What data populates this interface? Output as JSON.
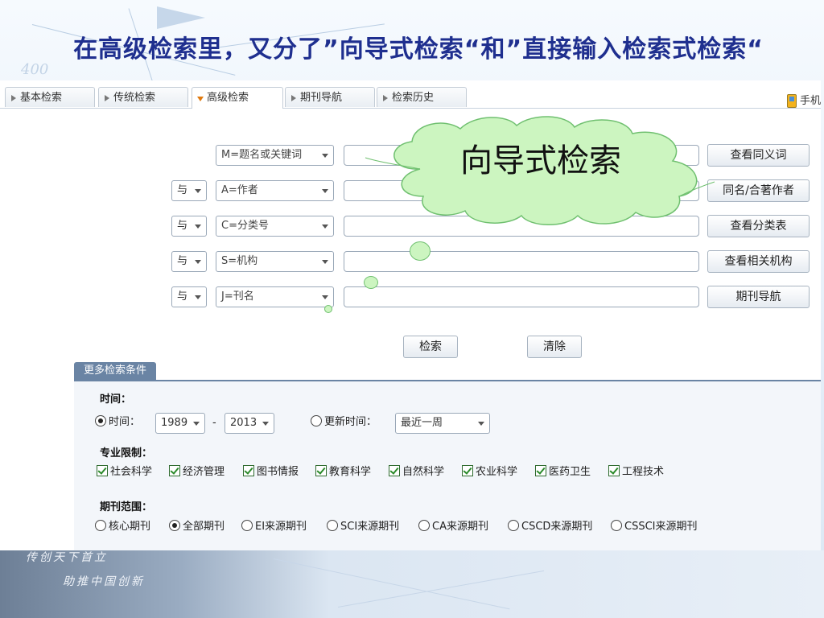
{
  "slide": {
    "title": "在高级检索里，又分了”向导式检索“和”直接输入检索式检索“",
    "deco_number": "400",
    "footer_line1": "传创天下首立",
    "footer_line2": "助推中国创新"
  },
  "tabs": [
    {
      "label": "基本检索",
      "active": false
    },
    {
      "label": "传统检索",
      "active": false
    },
    {
      "label": "高级检索",
      "active": true
    },
    {
      "label": "期刊导航",
      "active": false
    },
    {
      "label": "检索历史",
      "active": false
    }
  ],
  "mobile_label": "手机",
  "callout": {
    "text": "向导式检索"
  },
  "search_rows": [
    {
      "op": "",
      "field": "M=题名或关键词",
      "value": "",
      "button": "查看同义词"
    },
    {
      "op": "与",
      "field": "A=作者",
      "value": "",
      "button": "同名/合著作者"
    },
    {
      "op": "与",
      "field": "C=分类号",
      "value": "",
      "button": "查看分类表"
    },
    {
      "op": "与",
      "field": "S=机构",
      "value": "",
      "button": "查看相关机构"
    },
    {
      "op": "与",
      "field": "J=刊名",
      "value": "",
      "button": "期刊导航"
    }
  ],
  "actions": {
    "search": "检索",
    "clear": "清除"
  },
  "more_conditions": {
    "tab_label": "更多检索条件",
    "time": {
      "label": "时间：",
      "range_radio": "时间：",
      "range_selected": true,
      "from_year": "1989",
      "dash": "-",
      "to_year": "2013",
      "update_radio": "更新时间：",
      "update_selected": false,
      "update_value": "最近一周"
    },
    "subject": {
      "label": "专业限制：",
      "items": [
        {
          "label": "社会科学",
          "checked": true
        },
        {
          "label": "经济管理",
          "checked": true
        },
        {
          "label": "图书情报",
          "checked": true
        },
        {
          "label": "教育科学",
          "checked": true
        },
        {
          "label": "自然科学",
          "checked": true
        },
        {
          "label": "农业科学",
          "checked": true
        },
        {
          "label": "医药卫生",
          "checked": true
        },
        {
          "label": "工程技术",
          "checked": true
        }
      ]
    },
    "journal_scope": {
      "label": "期刊范围：",
      "items": [
        {
          "label": "核心期刊",
          "selected": false
        },
        {
          "label": "全部期刊",
          "selected": true
        },
        {
          "label": "EI来源期刊",
          "selected": false
        },
        {
          "label": "SCI来源期刊",
          "selected": false
        },
        {
          "label": "CA来源期刊",
          "selected": false
        },
        {
          "label": "CSCD来源期刊",
          "selected": false
        },
        {
          "label": "CSSCI来源期刊",
          "selected": false
        }
      ]
    }
  },
  "colors": {
    "title": "#1f2f8f",
    "cloud_fill": "#ccf5c0",
    "cloud_border": "#70c070",
    "more_tab": "#6a84a4",
    "active_tab_marker": "#e07a10"
  }
}
